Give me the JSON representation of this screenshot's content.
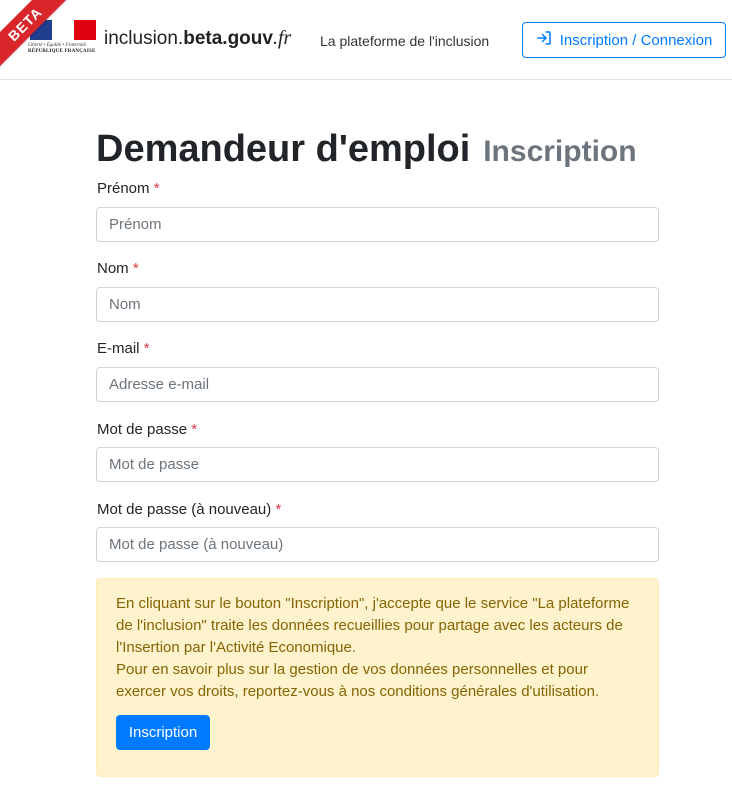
{
  "header": {
    "beta_badge": "BETA",
    "logo_devise": "Liberté • Égalité • Fraternité",
    "logo_republique": "RÉPUBLIQUE FRANÇAISE",
    "brand_prefix": "inclusion.",
    "brand_bold": "beta.gouv",
    "brand_suffix": ".fr",
    "tagline": "La plateforme de l'inclusion",
    "login_button": "Inscription / Connexion",
    "login_icon": "sign-in-icon",
    "flag_colors": [
      "#1f3e8f",
      "#ffffff",
      "#e1000f"
    ],
    "beta_color": "#d9262a"
  },
  "page": {
    "title": "Demandeur d'emploi",
    "subtitle": "Inscription"
  },
  "form": {
    "required_marker": "*",
    "fields": [
      {
        "label": "Prénom",
        "placeholder": "Prénom",
        "value": ""
      },
      {
        "label": "Nom",
        "placeholder": "Nom",
        "value": ""
      },
      {
        "label": "E-mail",
        "placeholder": "Adresse e-mail",
        "value": ""
      },
      {
        "label": "Mot de passe",
        "placeholder": "Mot de passe",
        "value": ""
      },
      {
        "label": "Mot de passe (à nouveau)",
        "placeholder": "Mot de passe (à nouveau)",
        "value": ""
      }
    ]
  },
  "notice": {
    "paragraph1": "En cliquant sur le bouton \"Inscription\", j'accepte que le service \"La plateforme de l'inclusion\" traite les données recueillies pour partage avec les acteurs de l'Insertion par l'Activité Economique.",
    "paragraph2": "Pour en savoir plus sur la gestion de vos données personnelles et pour exercer vos droits, reportez-vous à nos conditions générales d'utilisation.",
    "submit_button": "Inscription"
  },
  "colors": {
    "primary": "#007bff",
    "required": "#dc3545",
    "notice_bg": "#fff3cd",
    "notice_text": "#856404"
  }
}
